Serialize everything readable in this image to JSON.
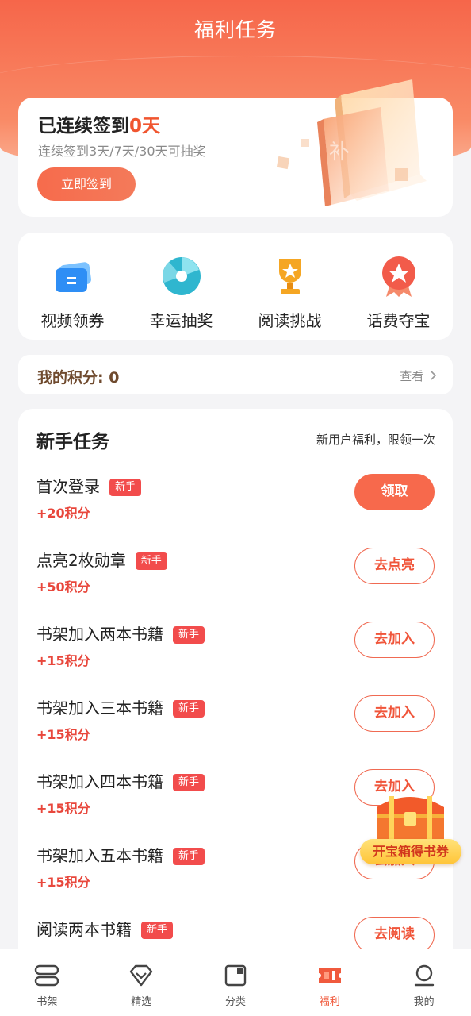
{
  "header": {
    "title": "福利任务"
  },
  "checkin": {
    "title_prefix": "已连续签到",
    "days": "0天",
    "subtitle": "连续签到3天/7天/30天可抽奖",
    "button": "立即签到",
    "illustration_char": "补"
  },
  "entries": [
    {
      "label": "视频领券",
      "icon": "ticket-icon",
      "color": "#2e8ef5"
    },
    {
      "label": "幸运抽奖",
      "icon": "lottery-disc-icon",
      "color": "#2fb6cf"
    },
    {
      "label": "阅读挑战",
      "icon": "trophy-icon",
      "color": "#f5a623"
    },
    {
      "label": "话费夺宝",
      "icon": "medal-icon",
      "color": "#f25b4a"
    }
  ],
  "points": {
    "label": "我的积分: 0",
    "view": "查看"
  },
  "tasks": {
    "title": "新手任务",
    "note": "新用户福利，限领一次",
    "badge": "新手",
    "items": [
      {
        "name": "首次登录",
        "points": "+20积分",
        "button": "领取"
      },
      {
        "name": "点亮2枚勋章",
        "points": "+50积分",
        "button": "去点亮"
      },
      {
        "name": "书架加入两本书籍",
        "points": "+15积分",
        "button": "去加入"
      },
      {
        "name": "书架加入三本书籍",
        "points": "+15积分",
        "button": "去加入"
      },
      {
        "name": "书架加入四本书籍",
        "points": "+15积分",
        "button": "去加入"
      },
      {
        "name": "书架加入五本书籍",
        "points": "+15积分",
        "button": "去加入"
      },
      {
        "name": "阅读两本书籍",
        "points": "",
        "button": "去阅读"
      }
    ]
  },
  "chest": {
    "label": "开宝箱得书券"
  },
  "tabs": [
    {
      "label": "书架",
      "icon": "bookshelf-icon"
    },
    {
      "label": "精选",
      "icon": "diamond-icon"
    },
    {
      "label": "分类",
      "icon": "category-icon"
    },
    {
      "label": "福利",
      "icon": "welfare-ticket-icon",
      "active": true
    },
    {
      "label": "我的",
      "icon": "profile-icon"
    }
  ],
  "colors": {
    "accent": "#f7694c",
    "points_red": "#e8473c",
    "badge_red": "#f24c4c"
  }
}
